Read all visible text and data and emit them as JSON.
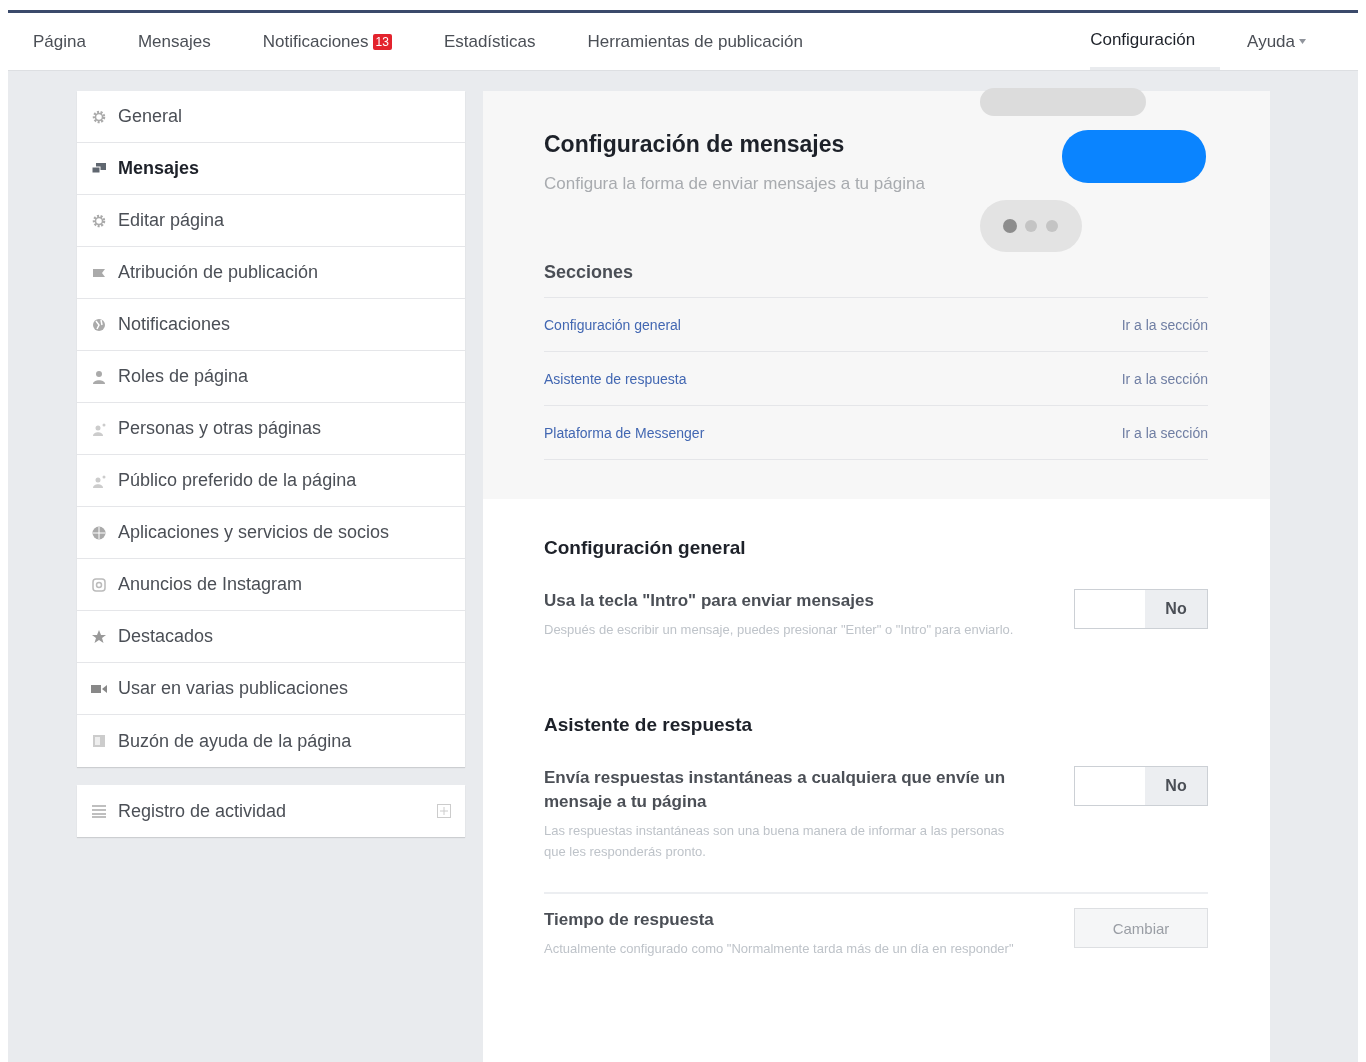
{
  "nav": {
    "items": [
      {
        "label": "Página",
        "selected": false
      },
      {
        "label": "Mensajes",
        "selected": false
      },
      {
        "label": "Notificaciones",
        "badge": "13",
        "selected": false
      },
      {
        "label": "Estadísticas",
        "selected": false
      },
      {
        "label": "Herramientas de publicación",
        "selected": false
      },
      {
        "label": "Configuración",
        "selected": true
      },
      {
        "label": "Ayuda",
        "dropdown": true,
        "selected": false
      }
    ]
  },
  "sidebar": {
    "items": [
      {
        "label": "General",
        "selected": false
      },
      {
        "label": "Mensajes",
        "selected": true
      },
      {
        "label": "Editar página",
        "selected": false
      },
      {
        "label": "Atribución de publicación",
        "selected": false
      },
      {
        "label": "Notificaciones",
        "selected": false
      },
      {
        "label": "Roles de página",
        "selected": false
      },
      {
        "label": "Personas y otras páginas",
        "selected": false
      },
      {
        "label": "Público preferido de la página",
        "selected": false
      },
      {
        "label": "Aplicaciones y servicios de socios",
        "selected": false
      },
      {
        "label": "Anuncios de Instagram",
        "selected": false
      },
      {
        "label": "Destacados",
        "selected": false
      },
      {
        "label": "Usar en varias publicaciones",
        "selected": false
      },
      {
        "label": "Buzón de ayuda de la página",
        "selected": false
      }
    ],
    "activity_log": {
      "label": "Registro de actividad"
    }
  },
  "header": {
    "title": "Configuración de mensajes",
    "subtitle": "Configura la forma de enviar mensajes a tu página",
    "sections_title": "Secciones",
    "sections": [
      {
        "label": "Configuración general",
        "link": "Ir a la sección"
      },
      {
        "label": "Asistente de respuesta",
        "link": "Ir a la sección"
      },
      {
        "label": "Plataforma de Messenger",
        "link": "Ir a la sección"
      }
    ]
  },
  "groups": [
    {
      "title": "Configuración general",
      "settings": [
        {
          "kind": "toggle",
          "label": "Usa la tecla \"Intro\" para enviar mensajes",
          "description": "Después de escribir un mensaje, puedes presionar \"Enter\" o \"Intro\" para enviarlo.",
          "value": "No",
          "on": false
        }
      ]
    },
    {
      "title": "Asistente de respuesta",
      "settings": [
        {
          "kind": "toggle",
          "label": "Envía respuestas instantáneas a cualquiera que envíe un mensaje a tu página",
          "description": "Las respuestas instantáneas son una buena manera de informar a las personas que les responderás pronto.",
          "value": "No",
          "on": false
        },
        {
          "kind": "button",
          "label": "Tiempo de respuesta",
          "description": "Actualmente configurado como \"Normalmente tarda más de un día en responder\"",
          "button": "Cambiar",
          "disabled": true
        }
      ]
    }
  ]
}
